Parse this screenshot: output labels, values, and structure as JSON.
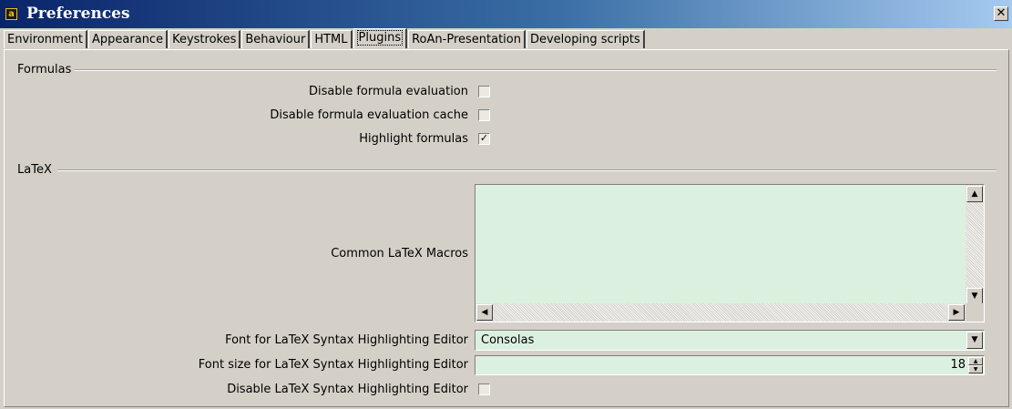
{
  "window": {
    "title": "Preferences",
    "icon": "app-icon",
    "close_label": "✕"
  },
  "tabs": [
    {
      "label": "Environment",
      "selected": false
    },
    {
      "label": "Appearance",
      "selected": false
    },
    {
      "label": "Keystrokes",
      "selected": false
    },
    {
      "label": "Behaviour",
      "selected": false
    },
    {
      "label": "HTML",
      "selected": false
    },
    {
      "label": "Plugins",
      "selected": true
    },
    {
      "label": "RoAn-Presentation",
      "selected": false
    },
    {
      "label": "Developing scripts",
      "selected": false
    }
  ],
  "formulas": {
    "group_label": "Formulas",
    "disable_eval_label": "Disable formula evaluation",
    "disable_eval_checked": false,
    "disable_cache_label": "Disable formula evaluation cache",
    "disable_cache_checked": false,
    "highlight_label": "Highlight formulas",
    "highlight_checked": true,
    "check_mark": "✓"
  },
  "latex": {
    "group_label": "LaTeX",
    "macros_label": "Common LaTeX Macros",
    "macros_value": "",
    "font_label": "Font for LaTeX Syntax Highlighting Editor",
    "font_value": "Consolas",
    "font_size_label": "Font size for LaTeX Syntax Highlighting Editor",
    "font_size_value": "18",
    "disable_editor_label": "Disable LaTeX Syntax Highlighting Editor",
    "disable_editor_checked": false
  },
  "colors": {
    "field_bg": "#dcf0e0",
    "window_bg": "#d4d0c8",
    "title_gradient_start": "#0a246a"
  }
}
